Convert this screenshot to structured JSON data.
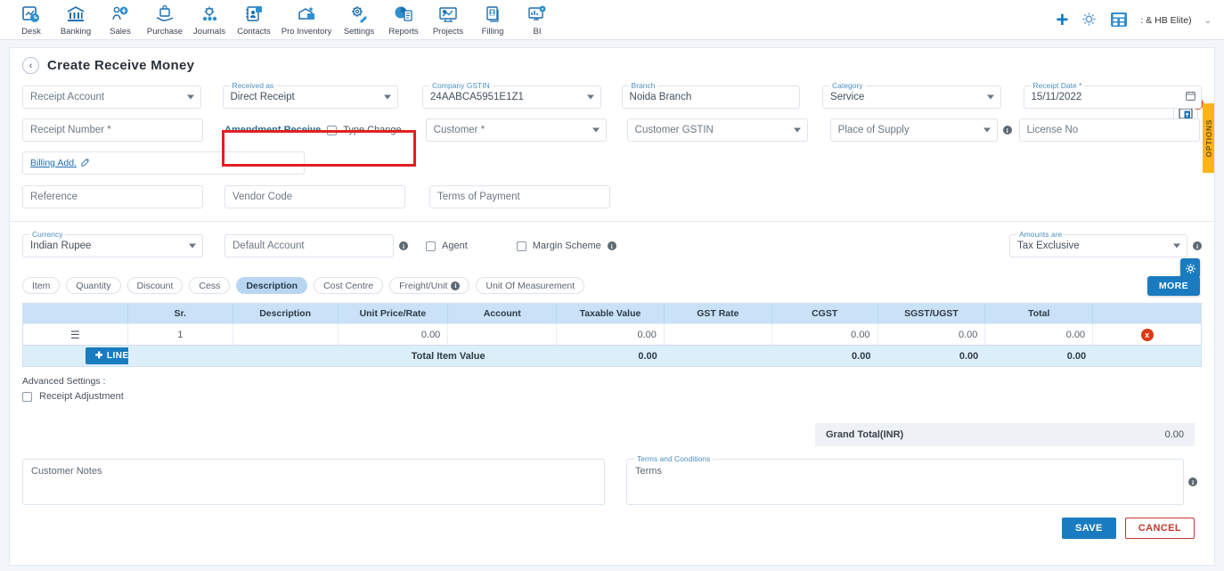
{
  "topnav": {
    "items": [
      {
        "label": "Desk",
        "icon": "desk-icon"
      },
      {
        "label": "Banking",
        "icon": "bank-icon"
      },
      {
        "label": "Sales",
        "icon": "sales-icon"
      },
      {
        "label": "Purchase",
        "icon": "purchase-icon"
      },
      {
        "label": "Journals",
        "icon": "journals-icon"
      },
      {
        "label": "Contacts",
        "icon": "contacts-icon"
      },
      {
        "label": "Pro Inventory",
        "icon": "inventory-icon"
      },
      {
        "label": "Settings",
        "icon": "settings-icon"
      },
      {
        "label": "Reports",
        "icon": "reports-icon"
      },
      {
        "label": "Projects",
        "icon": "projects-icon"
      },
      {
        "label": "Filling",
        "icon": "filling-icon"
      },
      {
        "label": "BI",
        "icon": "bi-icon"
      }
    ],
    "user_label": ": & HB Elite)",
    "accent": "#1a7cc0"
  },
  "header": {
    "title": "Create Receive Money",
    "back_icon": "chevron-left-icon",
    "upload_icon": "upload-icon",
    "upload_badge": "0",
    "options_tab": "OPTIONS"
  },
  "form": {
    "receipt_account": {
      "label": "",
      "placeholder": "Receipt Account",
      "value": ""
    },
    "received_as": {
      "label": "Received as",
      "value": "Direct Receipt",
      "highlighted": true
    },
    "company_gstin": {
      "label": "Company GSTIN",
      "value": "24AABCA5951E1Z1"
    },
    "branch": {
      "label": "Branch",
      "value": "Noida Branch"
    },
    "category": {
      "label": "Category",
      "value": "Service"
    },
    "receipt_date": {
      "label": "Receipt Date *",
      "value": "15/11/2022"
    },
    "receipt_number": {
      "label": "",
      "placeholder": "Receipt Number *",
      "value": ""
    },
    "amendment_receive": "Amendment Receive",
    "type_change": "Type Change",
    "customer": {
      "label": "",
      "placeholder": "Customer *",
      "value": ""
    },
    "customer_gstin": {
      "label": "",
      "placeholder": "Customer GSTIN",
      "value": ""
    },
    "place_of_supply": {
      "label": "",
      "placeholder": "Place of Supply",
      "value": ""
    },
    "license_no": {
      "label": "",
      "placeholder": "License No",
      "value": ""
    },
    "billing_add": "Billing Add.",
    "reference": {
      "placeholder": "Reference",
      "value": ""
    },
    "vendor_code": {
      "placeholder": "Vendor Code",
      "value": ""
    },
    "terms_of_payment": {
      "placeholder": "Terms of Payment",
      "value": ""
    },
    "currency": {
      "label": "Currency",
      "value": "Indian Rupee"
    },
    "default_account": {
      "placeholder": "Default Account",
      "value": ""
    },
    "agent": "Agent",
    "margin_scheme": "Margin Scheme",
    "amounts_are": {
      "label": "Amounts are",
      "value": "Tax Exclusive"
    }
  },
  "chips": [
    {
      "label": "Item",
      "active": false,
      "info": false
    },
    {
      "label": "Quantity",
      "active": false,
      "info": false
    },
    {
      "label": "Discount",
      "active": false,
      "info": false
    },
    {
      "label": "Cess",
      "active": false,
      "info": false
    },
    {
      "label": "Description",
      "active": true,
      "info": false
    },
    {
      "label": "Cost Centre",
      "active": false,
      "info": false
    },
    {
      "label": "Freight/Unit",
      "active": false,
      "info": true
    },
    {
      "label": "Unit Of Measurement",
      "active": false,
      "info": false
    }
  ],
  "more_button": "MORE",
  "table": {
    "columns": [
      "",
      "Sr.",
      "Description",
      "Unit Price/Rate",
      "Account",
      "Taxable Value",
      "GST Rate",
      "CGST",
      "SGST/UGST",
      "Total",
      ""
    ],
    "rows": [
      {
        "handle": "drag-handle-icon",
        "sr": "1",
        "description": "",
        "unit_price": "0.00",
        "account": "",
        "taxable_value": "0.00",
        "gst_rate": "",
        "cgst": "0.00",
        "sgst_ugst": "0.00",
        "total": "0.00",
        "delete": "x"
      }
    ],
    "footer": {
      "add_line": "LINE",
      "label": "Total Item Value",
      "taxable_value": "0.00",
      "gst_rate": "",
      "cgst": "0.00",
      "sgst_ugst": "0.00",
      "total": "0.00"
    }
  },
  "advanced": {
    "title": "Advanced Settings :",
    "receipt_adjustment": "Receipt Adjustment"
  },
  "totals": {
    "grand_total_label": "Grand Total(INR)",
    "grand_total_value": "0.00"
  },
  "bottom": {
    "customer_notes": {
      "placeholder": "Customer Notes",
      "value": ""
    },
    "terms": {
      "label": "Terms and Conditions",
      "value": "Terms"
    },
    "save": "SAVE",
    "cancel": "CANCEL"
  }
}
